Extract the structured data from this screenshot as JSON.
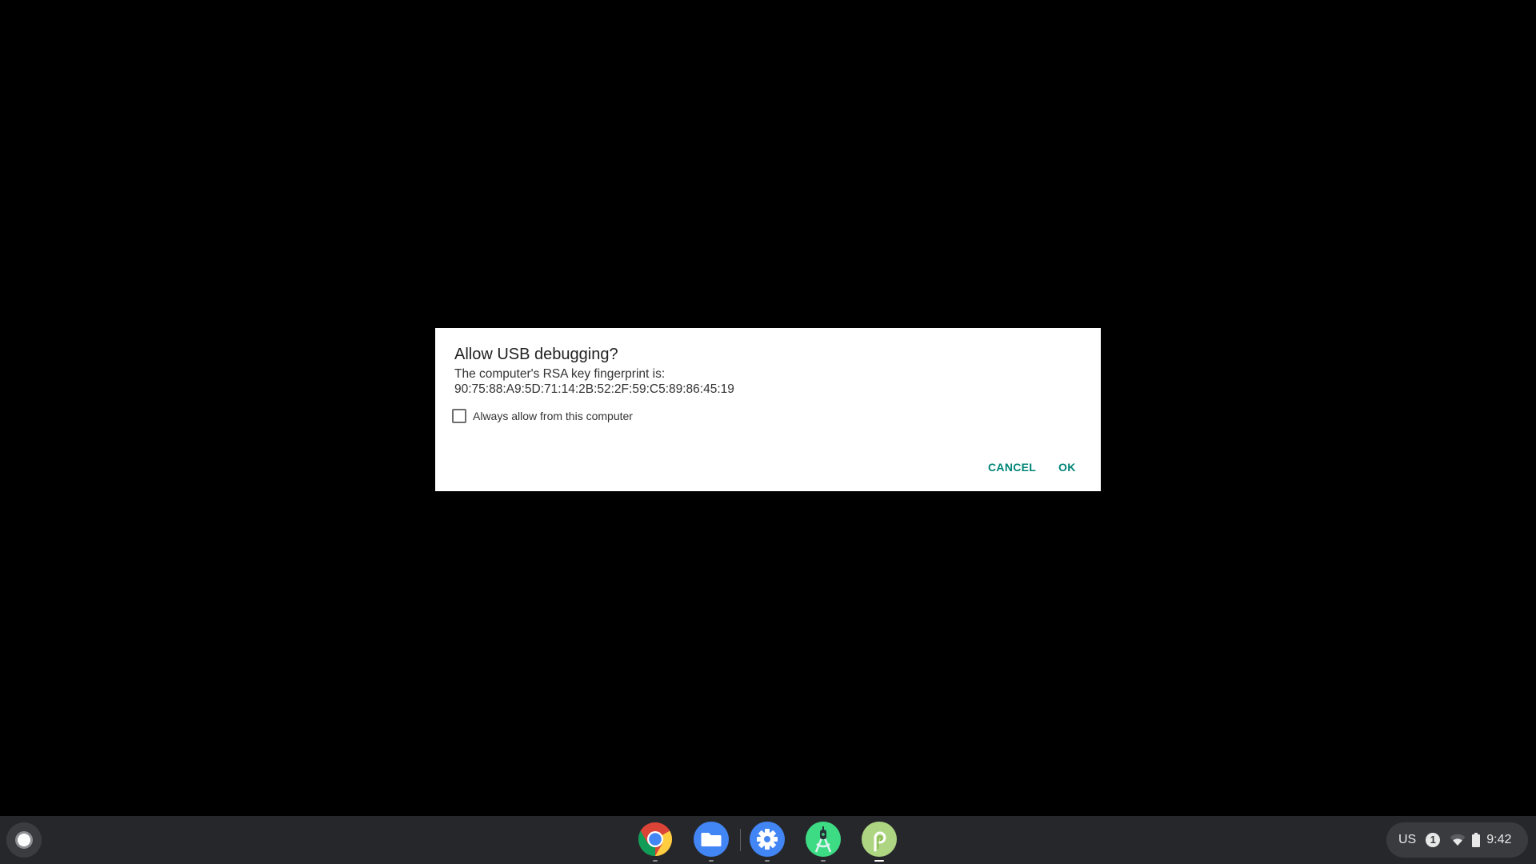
{
  "dialog": {
    "title": "Allow USB debugging?",
    "message_line1": "The computer's RSA key fingerprint is:",
    "message_line2": "90:75:88:A9:5D:71:14:2B:52:2F:59:C5:89:86:45:19",
    "checkbox_label": "Always allow from this computer",
    "checkbox_checked": false,
    "cancel_label": "CANCEL",
    "ok_label": "OK",
    "accent_color": "#008577"
  },
  "shelf": {
    "launcher_icon": "launcher-circle-icon",
    "apps": [
      {
        "name": "Chrome",
        "icon": "chrome-icon",
        "running": true,
        "active": false
      },
      {
        "name": "Files",
        "icon": "files-folder-icon",
        "running": true,
        "active": false
      },
      {
        "name": "Settings",
        "icon": "settings-gear-icon",
        "running": true,
        "active": false
      },
      {
        "name": "Android Studio",
        "icon": "android-studio-icon",
        "running": true,
        "active": false
      },
      {
        "name": "Android P",
        "icon": "android-p-icon",
        "running": true,
        "active": true
      }
    ]
  },
  "tray": {
    "ime": "US",
    "notification_count": "1",
    "wifi_icon": "wifi-icon",
    "battery_icon": "battery-icon",
    "time": "9:42"
  }
}
